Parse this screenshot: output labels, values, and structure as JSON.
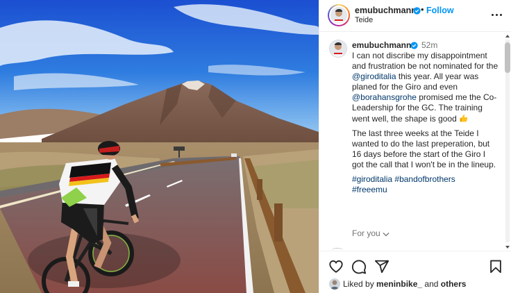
{
  "post": {
    "username": "emubuchmann",
    "follow_label": "Follow",
    "location": "Teide",
    "dot": "•"
  },
  "caption": {
    "username": "emubuchmann",
    "time": "52m",
    "p1_a": "I can not discribe my disappointment and frustration be not nominated for the ",
    "mention_giro": "@giroditalia",
    "p1_b": " this year. All year was planed for the Giro and even ",
    "mention_bora": "@borahansgrohe",
    "p1_c": " promised me the Co-Leadership for the GC. The training went well, the shape is good ",
    "p2": "The last three weeks at the Teide I wanted to do the last preperation, but 16 days before the start of the Giro I got the call that I won't be in the lineup.",
    "hashtag_giro": "#giroditalia",
    "hashtag_band": "#bandofbrothers",
    "hashtag_free": "#freeemu",
    "for_you": "For you"
  },
  "likes": {
    "prefix": "Liked by ",
    "user": "meninbike_",
    "middle": " and ",
    "others": "others"
  },
  "icons": {
    "verified": "verified-badge-icon",
    "more": "more-options-icon",
    "like": "heart-icon",
    "comment": "comment-icon",
    "share": "share-icon",
    "save": "bookmark-icon",
    "emoji": "thumbs-up-icon",
    "chevron": "chevron-down-icon"
  },
  "colors": {
    "link": "#00376b",
    "follow": "#0095f6",
    "verified": "#0095f6",
    "muted": "#737373"
  }
}
